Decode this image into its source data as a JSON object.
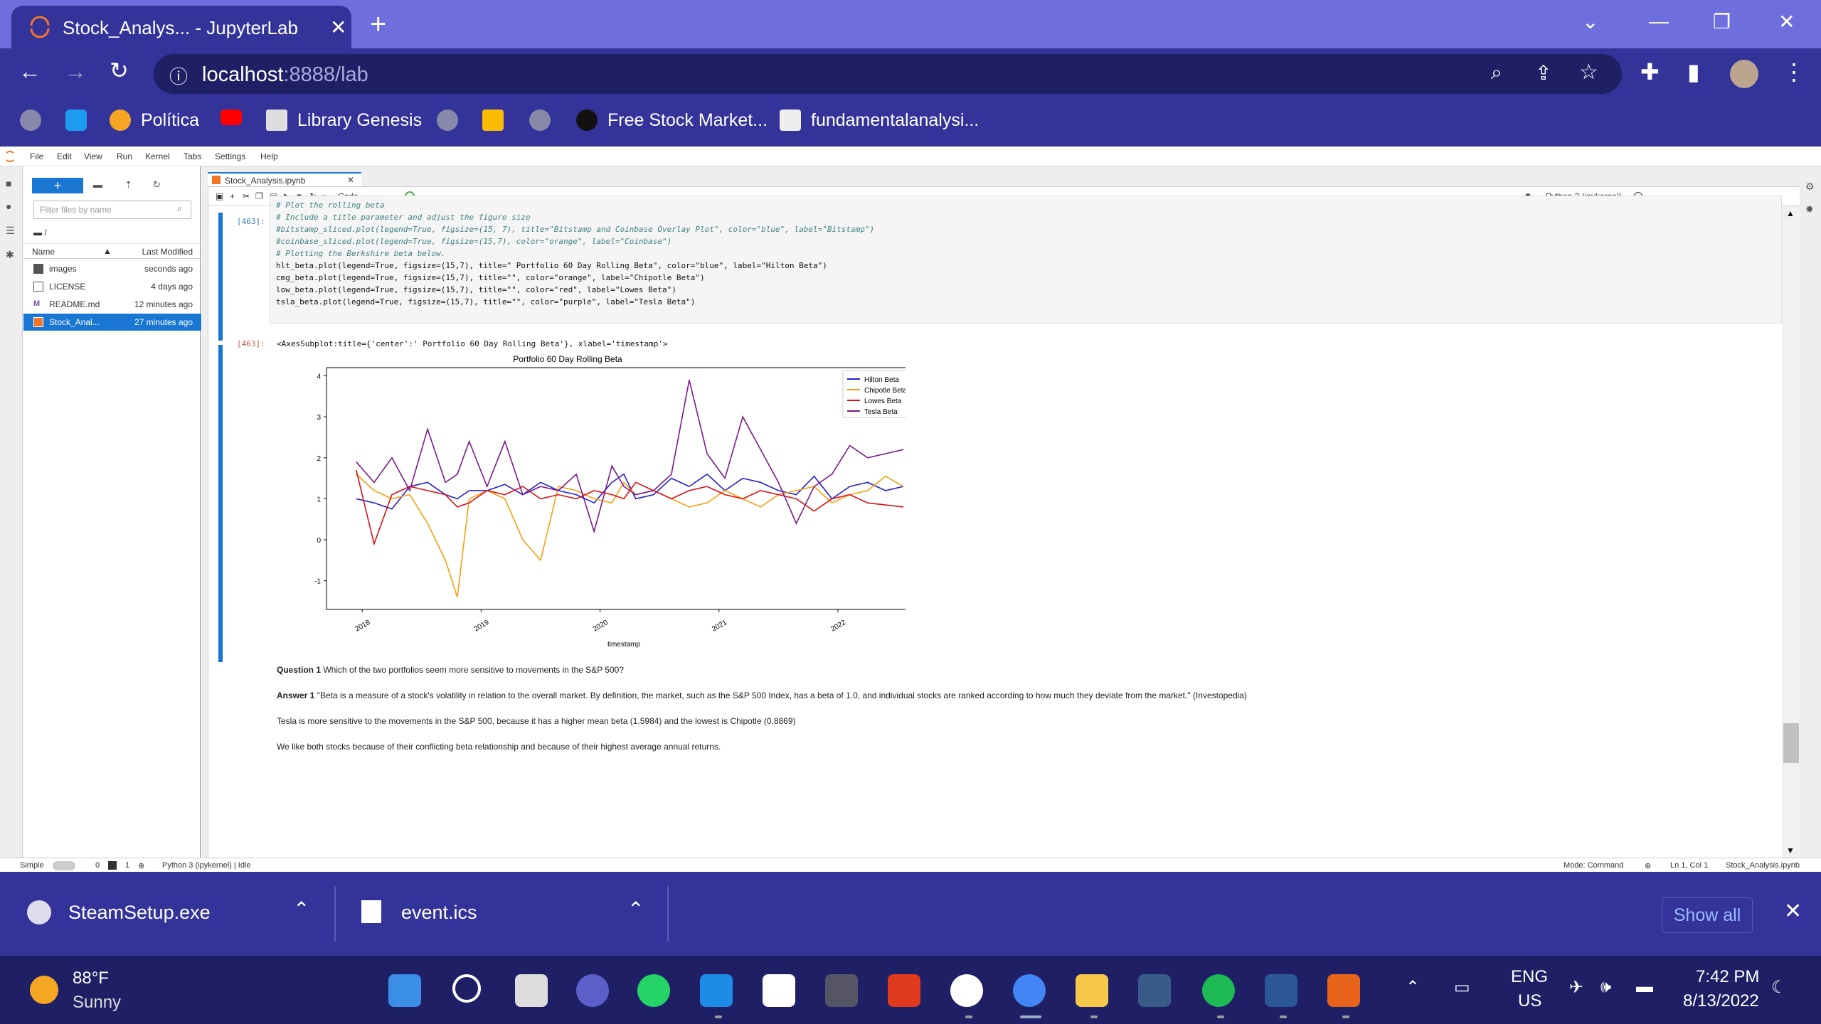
{
  "browser": {
    "tab_title": "Stock_Analys... - JupyterLab",
    "url_host": "localhost",
    "url_path": ":8888/lab",
    "bookmarks": [
      {
        "label": ""
      },
      {
        "label": ""
      },
      {
        "label": "Política"
      },
      {
        "label": ""
      },
      {
        "label": "Library Genesis"
      },
      {
        "label": ""
      },
      {
        "label": ""
      },
      {
        "label": ""
      },
      {
        "label": "Free Stock Market..."
      },
      {
        "label": "fundamentalanalysi..."
      }
    ]
  },
  "jupyter": {
    "menu": [
      "File",
      "Edit",
      "View",
      "Run",
      "Kernel",
      "Tabs",
      "Settings",
      "Help"
    ],
    "filter_placeholder": "Filter files by name",
    "path": "/",
    "col_name": "Name",
    "col_modified": "Last Modified",
    "files": [
      {
        "name": "images",
        "modified": "seconds ago",
        "type": "folder"
      },
      {
        "name": "LICENSE",
        "modified": "4 days ago",
        "type": "file"
      },
      {
        "name": "README.md",
        "modified": "12 minutes ago",
        "type": "markdown"
      },
      {
        "name": "Stock_Anal...",
        "modified": "27 minutes ago",
        "type": "notebook",
        "selected": true
      }
    ],
    "doc_tab": "Stock_Analysis.ipynb",
    "cell_type": "Code",
    "kernel": "Python 3 (ipykernel)",
    "in_prompt": "[463]:",
    "out_prompt": "[463]:",
    "code_lines": [
      "# Plot the rolling beta",
      "# Include a title parameter and adjust the figure size",
      "#bitstamp_sliced.plot(legend=True, figsize=(15, 7), title=\"Bitstamp and Coinbase Overlay Plot\", color=\"blue\", label=\"Bitstamp\")",
      "#coinbase_sliced.plot(legend=True, figsize=(15,7), color=\"orange\", label=\"Coinbase\")",
      "# Plotting the Berkshire beta below.",
      "hlt_beta.plot(legend=True, figsize=(15,7), title=\" Portfolio 60 Day Rolling Beta\", color=\"blue\", label=\"Hilton Beta\")",
      "cmg_beta.plot(legend=True, figsize=(15,7), title=\"\", color=\"orange\", label=\"Chipotle Beta\")",
      "low_beta.plot(legend=True, figsize=(15,7), title=\"\", color=\"red\", label=\"Lowes Beta\")",
      "tsla_beta.plot(legend=True, figsize=(15,7), title=\"\", color=\"purple\", label=\"Tesla Beta\")"
    ],
    "output_repr": "<AxesSubplot:title={'center':' Portfolio 60 Day Rolling Beta'}, xlabel='timestamp'>",
    "q1_label": "Question 1",
    "q1_text": "Which of the two portfolios seem more sensitive to movements in the S&P 500?",
    "a1_label": "Answer 1",
    "a1_text": "\"Beta is a measure of a stock's volatility in relation to the overall market. By definition, the market, such as the S&P 500 Index, has a beta of 1.0, and individual stocks are ranked according to how much they deviate from the market.\" (Investopedia)",
    "p2": "Tesla is more sensitive to the movements in the S&P 500, because it has a higher mean beta (1.5984) and the lowest is Chipotle (0.8869)",
    "p3": "We like both stocks because of their conflicting beta relationship and because of their highest average annual returns.",
    "status_left": "Simple",
    "status_counts": "0",
    "status_counts2": "1",
    "status_kernel": "Python 3 (ipykernel) | Idle",
    "status_mode": "Mode: Command",
    "status_pos": "Ln 1, Col 1",
    "status_file": "Stock_Analysis.ipynb"
  },
  "chart_data": {
    "type": "line",
    "title": "Portfolio 60 Day Rolling Beta",
    "xlabel": "timestamp",
    "ylabel": "",
    "x_ticks": [
      "2018",
      "2019",
      "2020",
      "2021",
      "2022"
    ],
    "y_ticks": [
      "-1",
      "0",
      "1",
      "2",
      "3",
      "4"
    ],
    "ylim": [
      -1.7,
      4.2
    ],
    "xlim": [
      2017.7,
      2022.7
    ],
    "legend_position": "top-right",
    "x": [
      2017.95,
      2018.1,
      2018.25,
      2018.4,
      2018.55,
      2018.7,
      2018.8,
      2018.9,
      2019.05,
      2019.2,
      2019.35,
      2019.5,
      2019.65,
      2019.8,
      2019.95,
      2020.1,
      2020.2,
      2020.3,
      2020.45,
      2020.6,
      2020.75,
      2020.9,
      2021.05,
      2021.2,
      2021.35,
      2021.5,
      2021.65,
      2021.8,
      2021.95,
      2022.1,
      2022.25,
      2022.4,
      2022.55
    ],
    "series": [
      {
        "name": "Hilton Beta",
        "color": "#1f1fcc",
        "values": [
          1.0,
          0.9,
          0.75,
          1.3,
          1.4,
          1.1,
          1.0,
          1.2,
          1.2,
          1.35,
          1.1,
          1.4,
          1.2,
          1.1,
          0.9,
          1.4,
          1.6,
          1.0,
          1.1,
          1.5,
          1.3,
          1.6,
          1.2,
          1.5,
          1.4,
          1.2,
          1.1,
          1.55,
          1.0,
          1.3,
          1.4,
          1.2,
          1.3
        ]
      },
      {
        "name": "Chipotle Beta",
        "color": "#f5a010",
        "values": [
          1.6,
          1.2,
          1.0,
          1.1,
          0.4,
          -0.5,
          -1.4,
          1.0,
          1.2,
          1.0,
          0.0,
          -0.5,
          1.3,
          1.2,
          1.0,
          0.9,
          1.4,
          1.1,
          1.2,
          1.0,
          0.8,
          0.9,
          1.2,
          1.0,
          0.8,
          1.1,
          1.2,
          1.3,
          0.9,
          1.1,
          1.2,
          1.55,
          1.3
        ]
      },
      {
        "name": "Lowes Beta",
        "color": "#dd1111",
        "values": [
          1.7,
          -0.1,
          1.1,
          1.3,
          1.2,
          1.1,
          0.8,
          0.9,
          1.2,
          1.1,
          1.3,
          1.0,
          1.1,
          1.0,
          1.2,
          1.1,
          1.0,
          1.4,
          1.2,
          1.0,
          1.2,
          1.3,
          1.1,
          1.0,
          1.2,
          1.1,
          1.0,
          0.7,
          1.0,
          1.1,
          0.9,
          0.85,
          0.8
        ]
      },
      {
        "name": "Tesla Beta",
        "color": "#7a1a8a",
        "values": [
          1.9,
          1.4,
          2.0,
          1.2,
          2.7,
          1.4,
          1.6,
          2.4,
          1.3,
          2.4,
          1.1,
          1.3,
          1.2,
          1.6,
          0.2,
          1.8,
          1.3,
          1.1,
          1.2,
          1.6,
          3.9,
          2.1,
          1.5,
          3.0,
          2.2,
          1.4,
          0.4,
          1.3,
          1.6,
          2.3,
          2.0,
          2.1,
          2.2
        ]
      }
    ]
  },
  "downloads": [
    {
      "name": "SteamSetup.exe"
    },
    {
      "name": "event.ics"
    }
  ],
  "show_all": "Show all",
  "taskbar": {
    "weather_temp": "88°F",
    "weather_desc": "Sunny",
    "lang1": "ENG",
    "lang2": "US",
    "time": "7:42 PM",
    "date": "8/13/2022"
  }
}
